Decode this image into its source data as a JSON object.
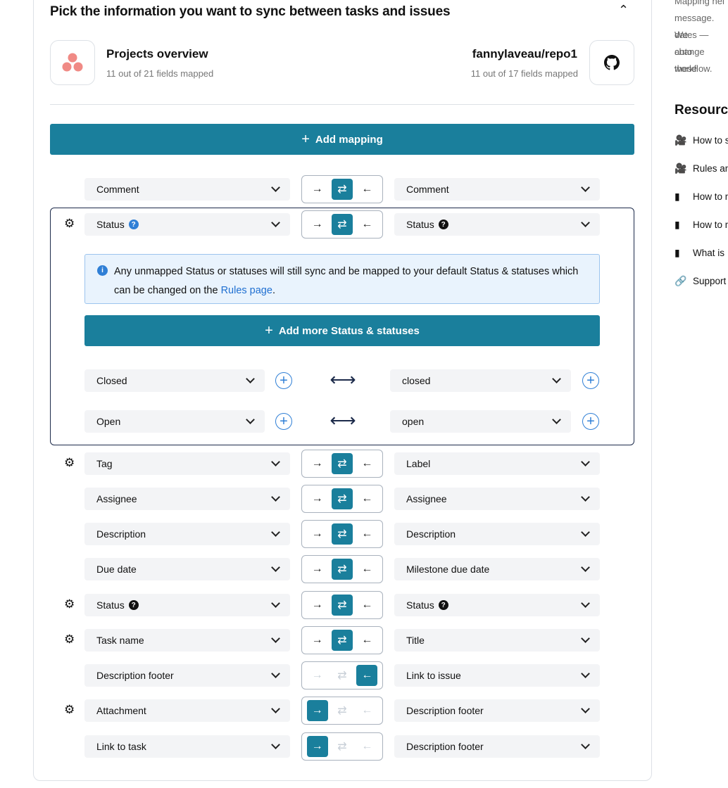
{
  "section": {
    "title": "Pick the information you want to sync between tasks and issues"
  },
  "left_project": {
    "name": "Projects overview",
    "mapped": "11 out of 21 fields mapped",
    "brand_color": "#f08a85"
  },
  "right_project": {
    "name": "fannylaveau/repo1",
    "mapped": "11 out of 17 fields mapped"
  },
  "add_mapping_label": "Add mapping",
  "accent_color": "#1a7f9c",
  "side_text": [
    "Mapping hel",
    "message. We",
    "dates — auto",
    "change these",
    "workflow."
  ],
  "resources": {
    "title": "Resources",
    "items": [
      {
        "icon": "video-camera-icon",
        "label": "How to s"
      },
      {
        "icon": "video-camera-icon",
        "label": "Rules an"
      },
      {
        "icon": "book-icon",
        "label": "How to m"
      },
      {
        "icon": "book-icon",
        "label": "How to m"
      },
      {
        "icon": "book-icon",
        "label": "What is"
      },
      {
        "icon": "link-icon",
        "label": "Support"
      }
    ]
  },
  "expanded": {
    "info": "Any unmapped Status or statuses will still sync and be mapped to your default Status & statuses which can be changed on the",
    "info_link": "Rules page",
    "info_end": ".",
    "add_more_label": "Add more Status & statuses",
    "values": [
      {
        "left": "Closed",
        "right": "closed"
      },
      {
        "left": "Open",
        "right": "open"
      }
    ]
  },
  "mappings": [
    {
      "left": "Comment",
      "right": "Comment",
      "direction": "both",
      "gear": false
    },
    {
      "left": "Status",
      "right": "Status",
      "direction": "both",
      "gear": true,
      "left_help": "blue",
      "right_help": "black"
    },
    {
      "left": "Tag",
      "right": "Label",
      "direction": "both",
      "gear": true
    },
    {
      "left": "Assignee",
      "right": "Assignee",
      "direction": "both",
      "gear": false
    },
    {
      "left": "Description",
      "right": "Description",
      "direction": "both",
      "gear": false
    },
    {
      "left": "Due date",
      "right": "Milestone due date",
      "direction": "both",
      "gear": false
    },
    {
      "left": "Status",
      "right": "Status",
      "direction": "both",
      "gear": true,
      "left_help": "black",
      "right_help": "black"
    },
    {
      "left": "Task name",
      "right": "Title",
      "direction": "both",
      "gear": true
    },
    {
      "left": "Description footer",
      "right": "Link to issue",
      "direction": "left",
      "gear": false
    },
    {
      "left": "Attachment",
      "right": "Description footer",
      "direction": "right",
      "gear": true
    },
    {
      "left": "Link to task",
      "right": "Description footer",
      "direction": "right",
      "gear": false
    }
  ]
}
